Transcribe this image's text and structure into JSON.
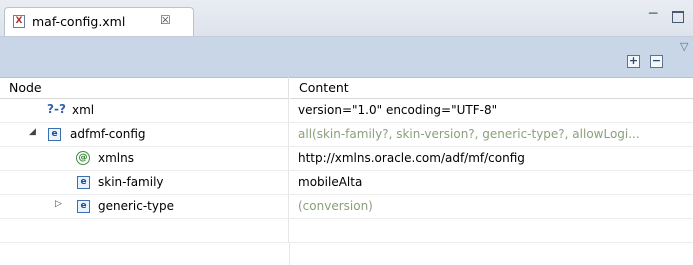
{
  "tab": {
    "icon": "xml-file-icon",
    "icon_glyph": "X",
    "title": "maf-config.xml",
    "close_glyph": "☒"
  },
  "window": {
    "min_glyph": "─"
  },
  "toolbar": {
    "expand_glyph": "+",
    "collapse_glyph": "−",
    "menu_glyph": "▽"
  },
  "columns": {
    "node": "Node",
    "content": "Content"
  },
  "rows": [
    {
      "glyph": "?-?",
      "name": "xml",
      "content": "version=\"1.0\" encoding=\"UTF-8\""
    },
    {
      "twisty": "◢",
      "glyph": "e",
      "name": "adfmf-config",
      "content": "all(skin-family?, skin-version?, generic-type?, allowLogi..."
    },
    {
      "glyph": "@",
      "name": "xmlns",
      "content": "http://xmlns.oracle.com/adf/mf/config"
    },
    {
      "glyph": "e",
      "name": "skin-family",
      "content": "mobileAlta"
    },
    {
      "twisty": "▷",
      "glyph": "e",
      "name": "generic-type",
      "content": "(conversion)"
    }
  ],
  "colors": {
    "tabbar": "#dde3ec",
    "toolbar": "#c9d6e8",
    "hint_text": "#8aa07a"
  }
}
